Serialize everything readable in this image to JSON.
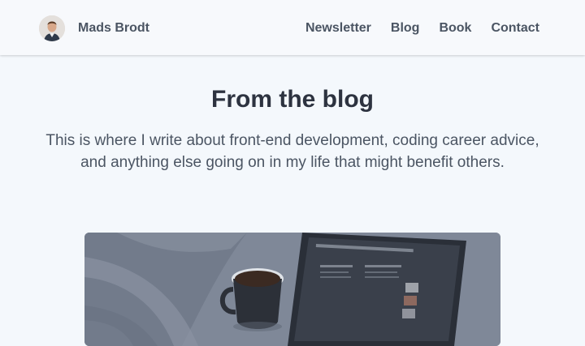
{
  "header": {
    "brand_name": "Mads Brodt",
    "nav": [
      {
        "label": "Newsletter"
      },
      {
        "label": "Blog"
      },
      {
        "label": "Book"
      },
      {
        "label": "Contact"
      }
    ]
  },
  "main": {
    "title": "From the blog",
    "intro": "This is where I write about front-end development, coding career advice, and anything else going on in my life that might benefit others."
  },
  "colors": {
    "page_background": "#f4f8fc",
    "heading": "#2d3340",
    "nav_text": "#4b5563"
  }
}
